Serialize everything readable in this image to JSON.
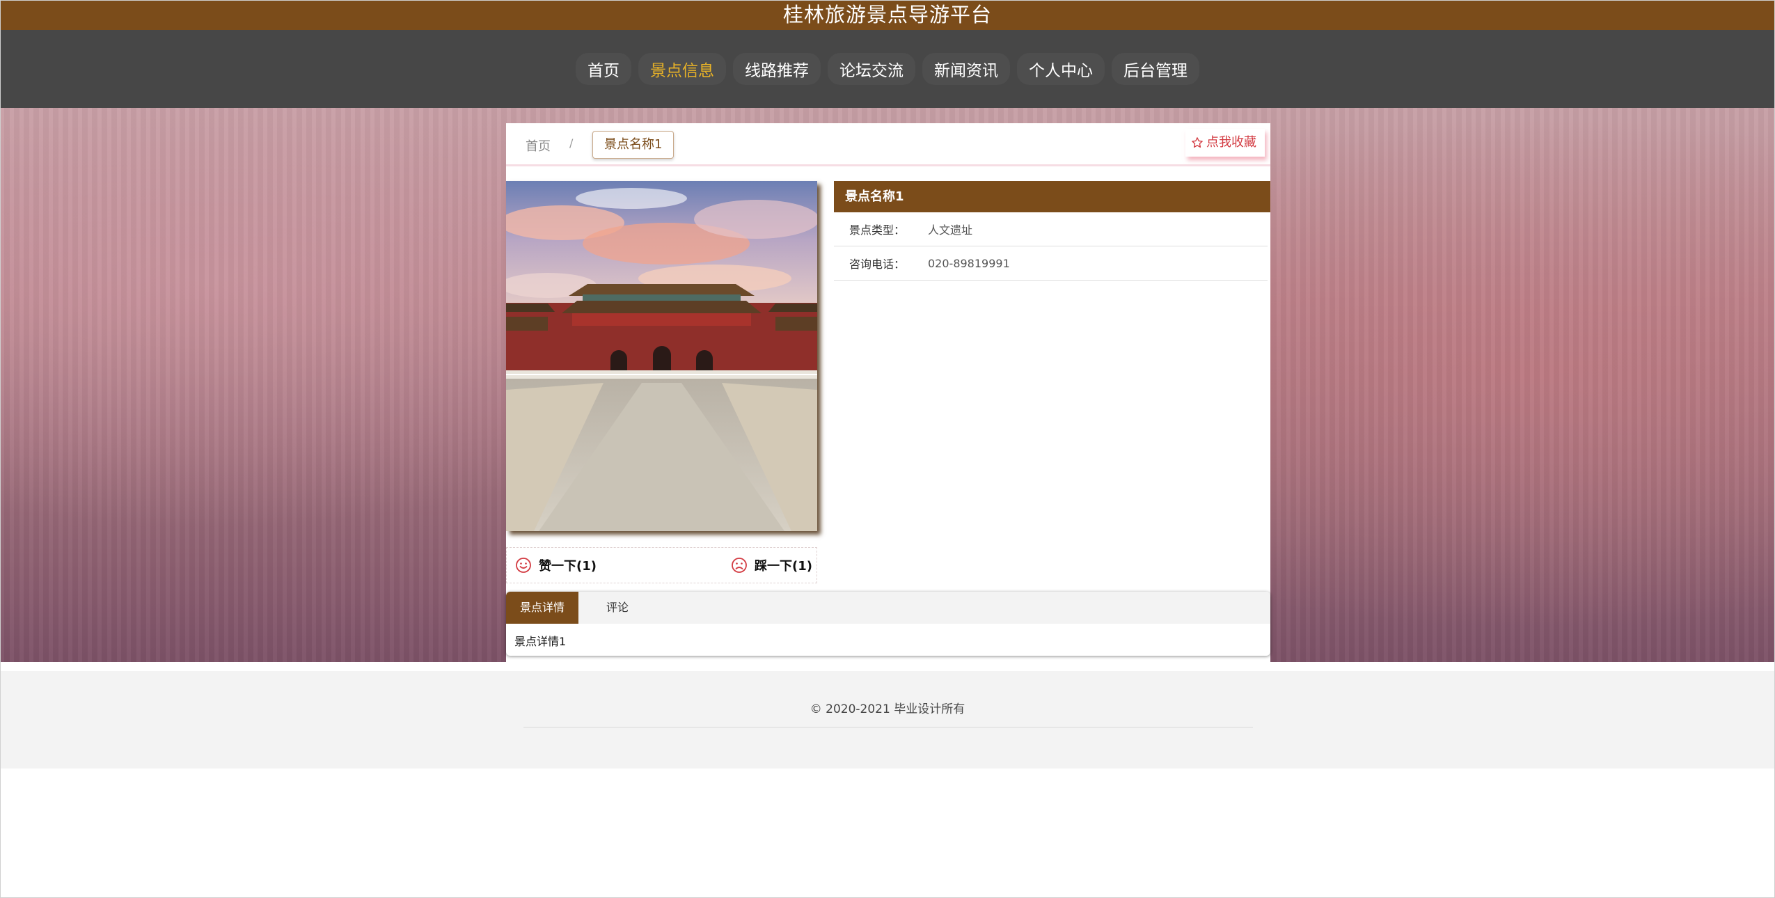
{
  "site": {
    "title": "桂林旅游景点导游平台"
  },
  "nav": {
    "items": [
      {
        "label": "首页",
        "active": false
      },
      {
        "label": "景点信息",
        "active": true
      },
      {
        "label": "线路推荐",
        "active": false
      },
      {
        "label": "论坛交流",
        "active": false
      },
      {
        "label": "新闻资讯",
        "active": false
      },
      {
        "label": "个人中心",
        "active": false
      },
      {
        "label": "后台管理",
        "active": false
      }
    ],
    "active_color": "#e9b327"
  },
  "breadcrumb": {
    "home": "首页",
    "separator": "/",
    "current": "景点名称1"
  },
  "favorite": {
    "label": "点我收藏",
    "icon": "star-outline-icon",
    "color": "#d33b42"
  },
  "spot": {
    "name": "景点名称1",
    "fields": [
      {
        "label": "景点类型：",
        "value": "人文遗址"
      },
      {
        "label": "咨询电话：",
        "value": "020-89819991"
      }
    ]
  },
  "votes": {
    "like_label": "赞一下(1)",
    "like_icon": "smile-icon",
    "dislike_label": "踩一下(1)",
    "dislike_icon": "frown-icon"
  },
  "tabs": {
    "items": [
      {
        "label": "景点详情",
        "active": true
      },
      {
        "label": "评论",
        "active": false
      }
    ],
    "content": "景点详情1"
  },
  "footer": {
    "copyright": "© 2020-2021 毕业设计所有"
  },
  "colors": {
    "brand": "#7b4c1a",
    "nav_bg": "#474747",
    "footer_bg": "#f3f3f3"
  }
}
